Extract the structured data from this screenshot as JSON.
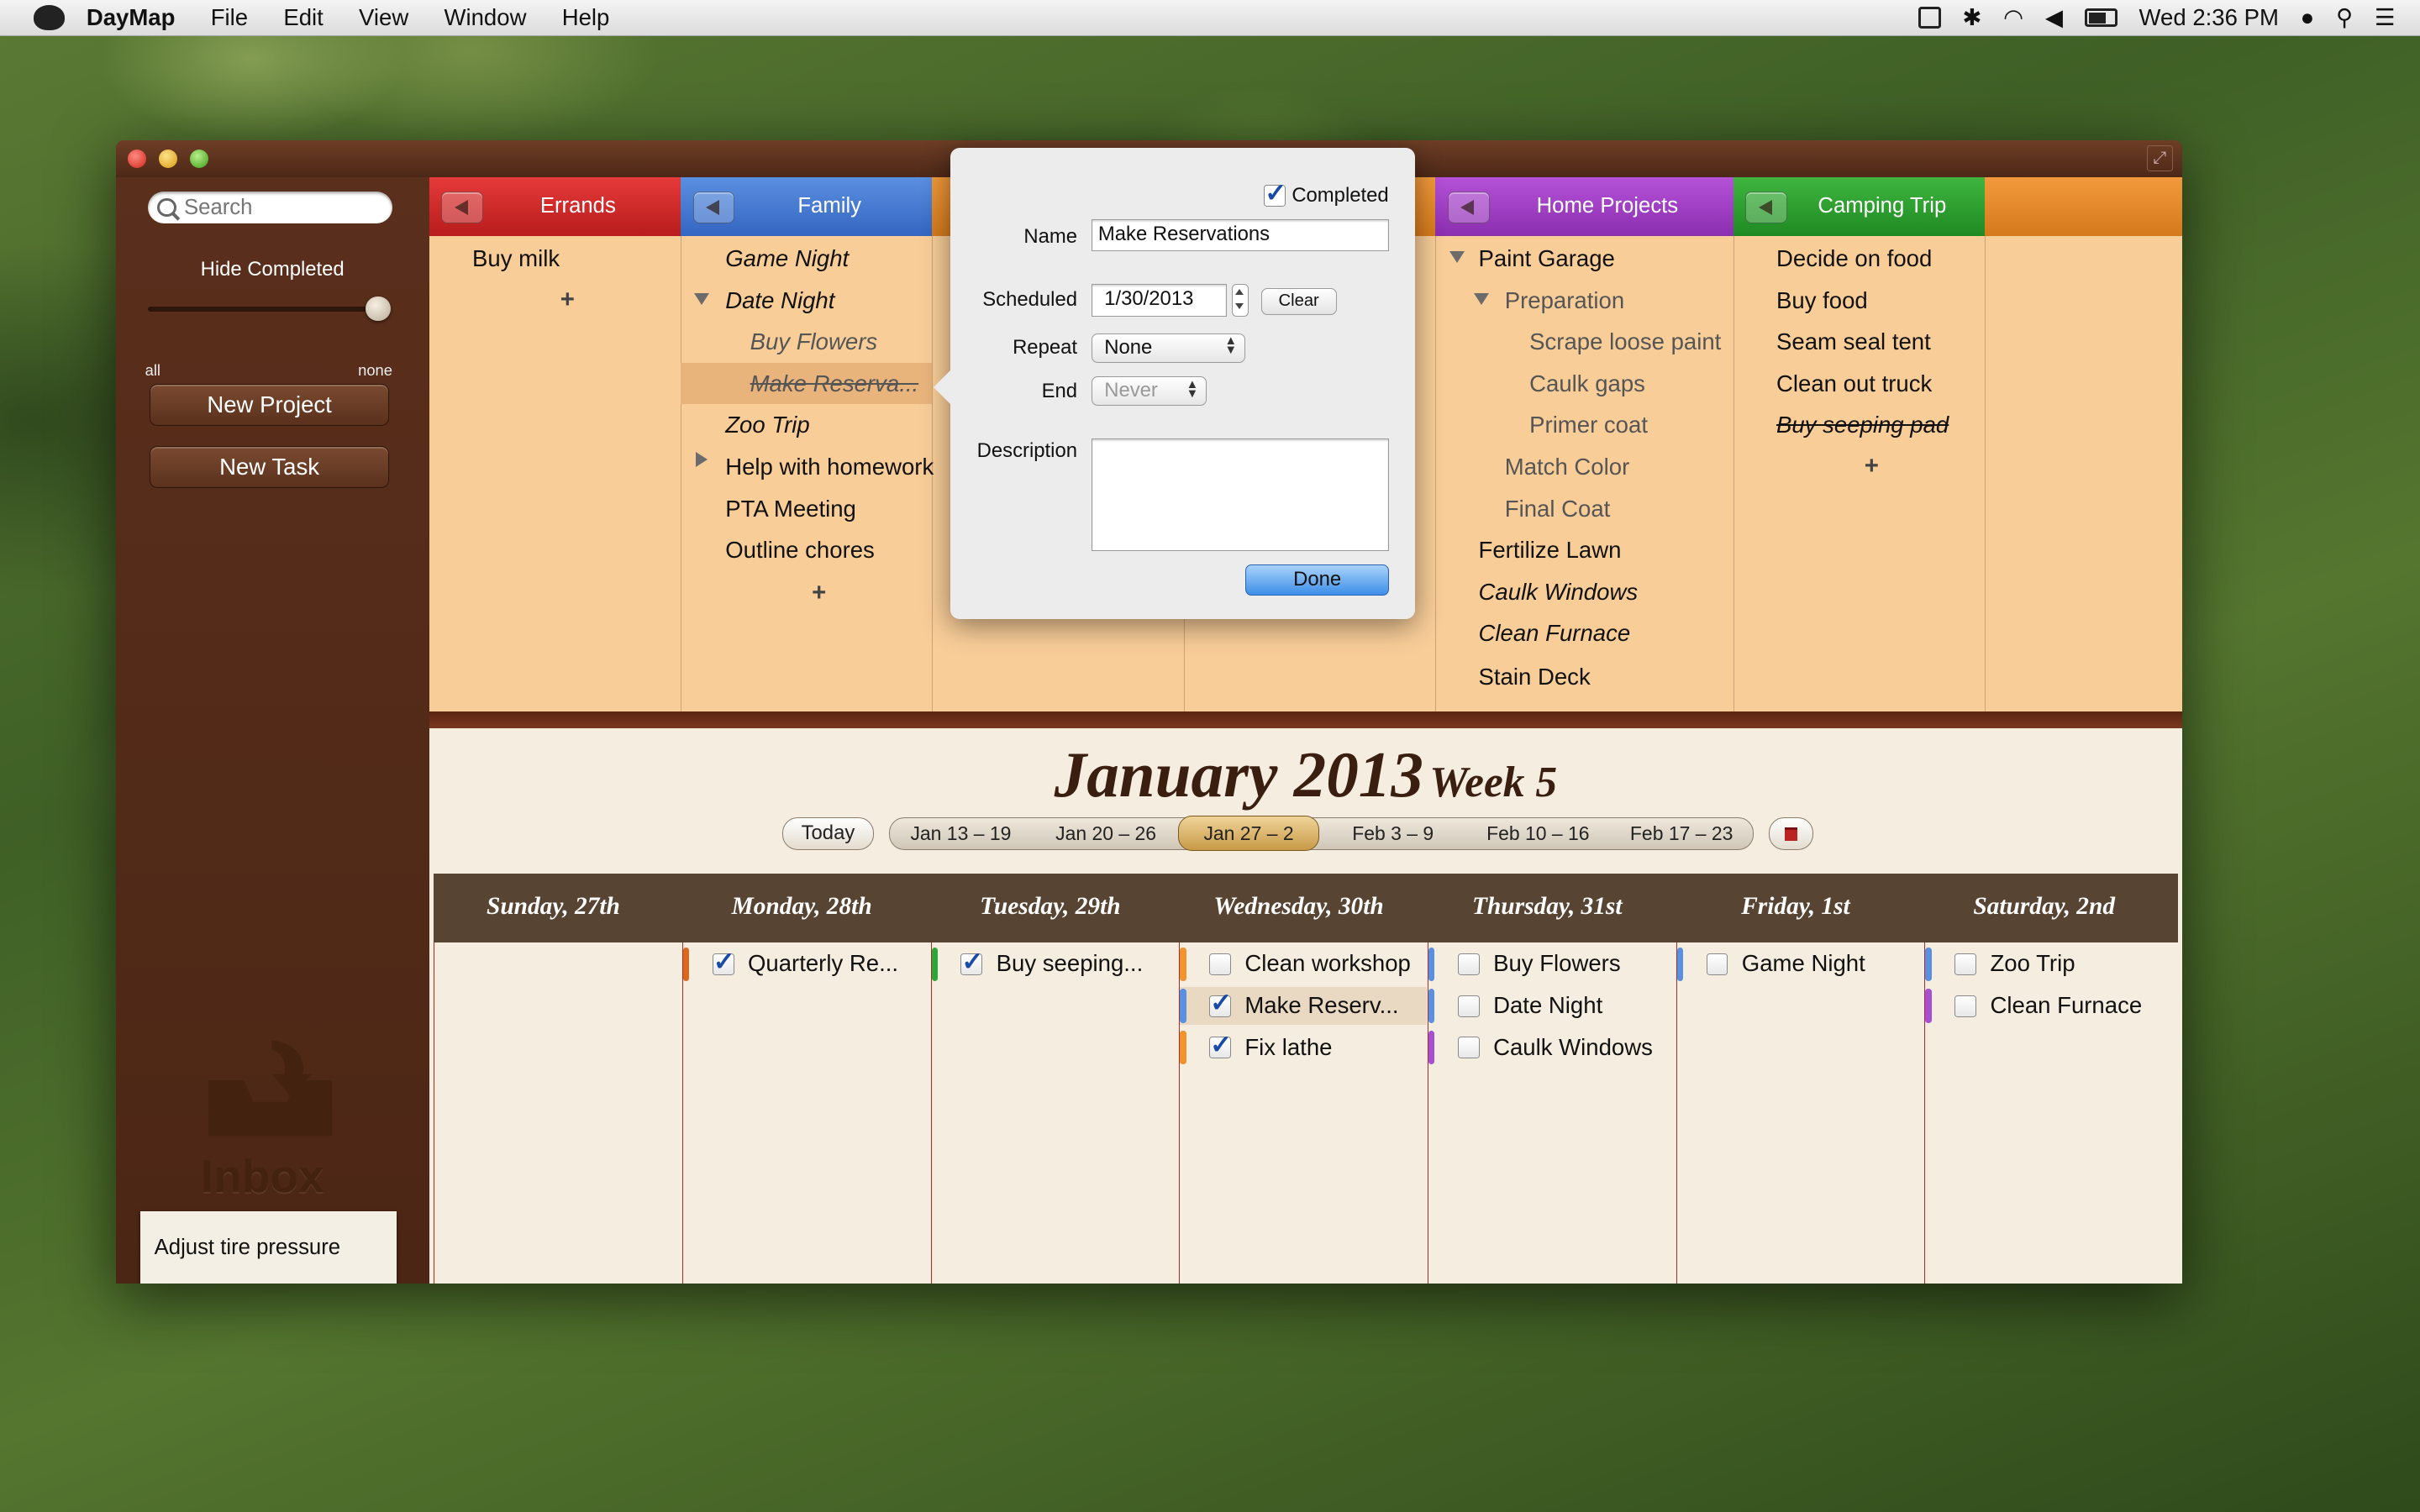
{
  "menubar": {
    "app": "DayMap",
    "menus": [
      "File",
      "Edit",
      "View",
      "Window",
      "Help"
    ],
    "clock": "Wed 2:36 PM"
  },
  "window": {
    "title": "DayMap"
  },
  "sidebar": {
    "search_placeholder": "Search",
    "hide_completed": "Hide Completed",
    "slider_min": "all",
    "slider_max": "none",
    "slider_level": 1.0,
    "new_project": "New Project",
    "new_task": "New Task",
    "inbox_label": "Inbox",
    "inbox_note": "Adjust tire pressure"
  },
  "projects": [
    {
      "name": "Errands",
      "color": "#d22a2a",
      "tasks": [
        {
          "label": "Buy milk"
        }
      ]
    },
    {
      "name": "Family",
      "color": "#4a7ad2",
      "tasks": [
        {
          "label": "Game Night",
          "italic": true
        },
        {
          "label": "Date Night",
          "italic": true,
          "expanded": true
        },
        {
          "label": "Buy Flowers",
          "italic": true,
          "indent": 1
        },
        {
          "label": "Make Reserva...",
          "italic": true,
          "indent": 1,
          "completed": true,
          "selected": true
        },
        {
          "label": "Zoo Trip",
          "italic": true
        },
        {
          "label": "Help with homework",
          "collapsed": true
        },
        {
          "label": "PTA Meeting"
        },
        {
          "label": "Outline chores"
        }
      ]
    },
    {
      "name": "Home Projects",
      "color": "#a03fc6",
      "tasks": [
        {
          "label": "Paint Garage",
          "expanded": true
        },
        {
          "label": "Preparation",
          "indent": 1,
          "expanded": true
        },
        {
          "label": "Scrape loose paint",
          "indent": 2
        },
        {
          "label": "Caulk gaps",
          "indent": 2
        },
        {
          "label": "Primer coat",
          "indent": 2
        },
        {
          "label": "Match Color",
          "indent": 1
        },
        {
          "label": "Final Coat",
          "indent": 1
        },
        {
          "label": "Fertilize Lawn"
        },
        {
          "label": "Caulk Windows",
          "italic": true
        },
        {
          "label": "Clean Furnace",
          "italic": true
        },
        {
          "label": "Stain Deck"
        }
      ]
    },
    {
      "name": "Camping Trip",
      "color": "#2a9e2c",
      "tasks": [
        {
          "label": "Decide on food"
        },
        {
          "label": "Buy food"
        },
        {
          "label": "Seam seal tent"
        },
        {
          "label": "Clean out truck"
        },
        {
          "label": "Buy seeping pad",
          "italic": true,
          "completed": true
        }
      ]
    }
  ],
  "popover": {
    "completed_label": "Completed",
    "completed": true,
    "name_label": "Name",
    "name_value": "Make Reservations",
    "scheduled_label": "Scheduled",
    "scheduled_value": "1/30/2013",
    "clear": "Clear",
    "repeat_label": "Repeat",
    "repeat_value": "None",
    "end_label": "End",
    "end_value": "Never",
    "description_label": "Description",
    "description_value": "",
    "done": "Done"
  },
  "calendar": {
    "month": "January 2013",
    "week": "Week 5",
    "today": "Today",
    "weeks": [
      "Jan 13 – 19",
      "Jan 20 – 26",
      "Jan 27 – 2",
      "Feb 3 – 9",
      "Feb 10 – 16",
      "Feb 17 – 23"
    ],
    "active_week": "Jan 27 – 2",
    "days": [
      {
        "title": "Sunday, 27th",
        "tasks": []
      },
      {
        "title": "Monday, 28th",
        "tasks": [
          {
            "label": "Quarterly Re...",
            "checked": true,
            "color": "#d86a1f"
          }
        ]
      },
      {
        "title": "Tuesday, 29th",
        "tasks": [
          {
            "label": "Buy seeping...",
            "checked": true,
            "color": "#2aa83a"
          }
        ]
      },
      {
        "title": "Wednesday, 30th",
        "tasks": [
          {
            "label": "Clean workshop",
            "checked": false,
            "color": "#f0922e"
          },
          {
            "label": "Make Reserv...",
            "checked": true,
            "color": "#5b8fe0",
            "selected": true
          },
          {
            "label": "Fix lathe",
            "checked": true,
            "color": "#f0922e"
          }
        ]
      },
      {
        "title": "Thursday, 31st",
        "tasks": [
          {
            "label": "Buy Flowers",
            "checked": false,
            "color": "#5b8fe0"
          },
          {
            "label": "Date Night",
            "checked": false,
            "color": "#5b8fe0"
          },
          {
            "label": "Caulk Windows",
            "checked": false,
            "color": "#a64fd0"
          }
        ]
      },
      {
        "title": "Friday, 1st",
        "tasks": [
          {
            "label": "Game Night",
            "checked": false,
            "color": "#5b8fe0"
          }
        ]
      },
      {
        "title": "Saturday, 2nd",
        "tasks": [
          {
            "label": "Zoo Trip",
            "checked": false,
            "color": "#5b8fe0"
          },
          {
            "label": "Clean Furnace",
            "checked": false,
            "color": "#a64fd0"
          }
        ]
      }
    ]
  }
}
